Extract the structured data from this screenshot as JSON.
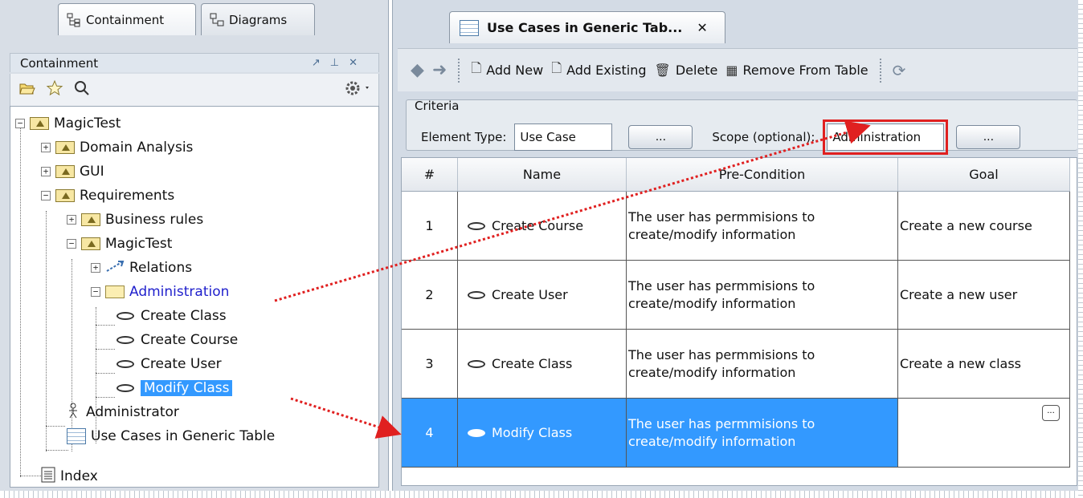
{
  "left_pane": {
    "tabs": [
      {
        "label": "Containment"
      },
      {
        "label": "Diagrams"
      }
    ],
    "header_title": "Containment",
    "header_controls": "↗ ⊕ ✕",
    "tree": [
      {
        "label": "MagicTest"
      },
      {
        "label": "Domain Analysis"
      },
      {
        "label": "GUI"
      },
      {
        "label": "Requirements"
      },
      {
        "label": "Business rules"
      },
      {
        "label": "MagicTest"
      },
      {
        "label": "Relations"
      },
      {
        "label": "Administration"
      },
      {
        "label": "Create Class"
      },
      {
        "label": "Create Course"
      },
      {
        "label": "Create User"
      },
      {
        "label": "Modify Class"
      },
      {
        "label": "Administrator"
      },
      {
        "label": "Use Cases in Generic Table"
      },
      {
        "label": "Index"
      }
    ]
  },
  "editor": {
    "tab_title": "Use Cases in Generic Tab...",
    "toolbar": {
      "add_new": "Add New",
      "add_existing": "Add Existing",
      "delete": "Delete",
      "remove_from_table": "Remove From Table"
    },
    "criteria": {
      "legend": "Criteria",
      "element_type_label": "Element Type:",
      "element_type_value": "Use Case",
      "scope_label": "Scope (optional):",
      "scope_value": "Administration",
      "browse": "..."
    },
    "table": {
      "columns": [
        "#",
        "Name",
        "Pre-Condition",
        "Goal"
      ],
      "rows": [
        {
          "num": "1",
          "name": "Create Course",
          "pre1": "The user has permmisions to",
          "pre2": "create/modify information",
          "goal": "Create a new course"
        },
        {
          "num": "2",
          "name": "Create User",
          "pre1": "The user has permmisions to",
          "pre2": "create/modify information",
          "goal": "Create a new user"
        },
        {
          "num": "3",
          "name": "Create Class",
          "pre1": "The user has permmisions to",
          "pre2": "create/modify information",
          "goal": "Create a new class"
        },
        {
          "num": "4",
          "name": "Modify Class",
          "pre1": "The user has permmisions to",
          "pre2": "create/modify information",
          "goal": ""
        }
      ],
      "more_button": "..."
    }
  },
  "colors": {
    "selection": "#3399ff",
    "highlight_red": "#e02020",
    "link_blue": "#1f1fcc"
  }
}
